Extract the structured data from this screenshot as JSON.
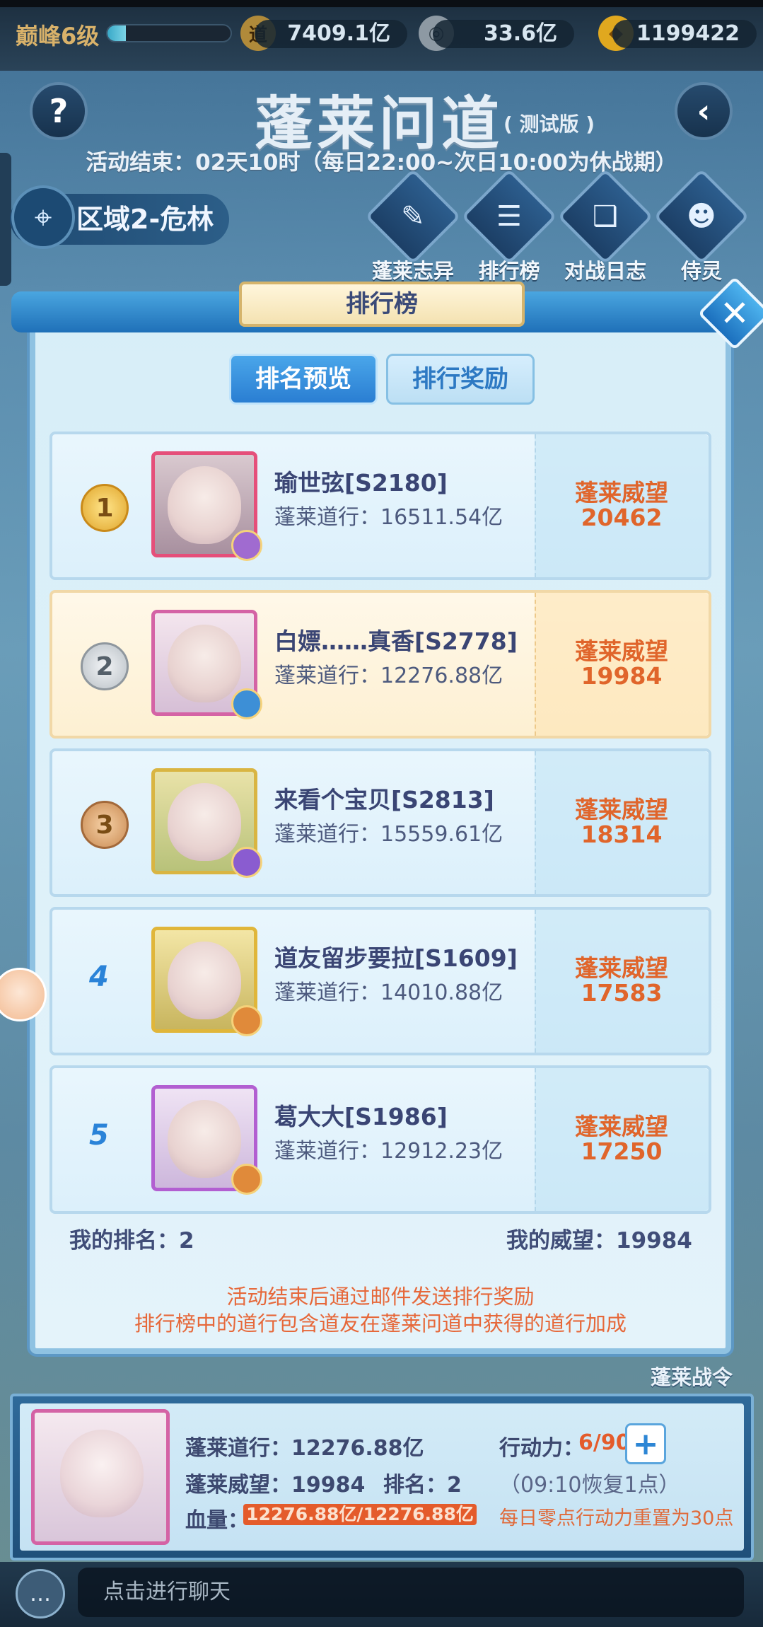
{
  "topbar": {
    "level": "巅峰6级",
    "level_progress": 0.15,
    "daoxing_icon": "道",
    "daoxing": "7409.1亿",
    "silver": "33.6亿",
    "gold": "1199422"
  },
  "header": {
    "title": "蓬莱问道",
    "version_tag": "( 测试版 )",
    "event_time": "活动结束：02天10时（每日22:00~次日10:00为休战期）",
    "region": "区域2-危林",
    "features": [
      "蓬莱志异",
      "排行榜",
      "对战日志",
      "侍灵"
    ]
  },
  "modal": {
    "title": "排行榜",
    "tabs": [
      "排名预览",
      "排行奖励"
    ],
    "active_tab": "排名预览",
    "prestige_label": "蓬莱威望",
    "rows": [
      {
        "rank": "1",
        "name": "瑜世弦[S2180]",
        "stat": "蓬莱道行：16511.54亿",
        "prestige": "20462"
      },
      {
        "rank": "2",
        "name": "白嫖……真香[S2778]",
        "stat": "蓬莱道行：12276.88亿",
        "prestige": "19984",
        "is_me": true
      },
      {
        "rank": "3",
        "name": "来看个宝贝[S2813]",
        "stat": "蓬莱道行：15559.61亿",
        "prestige": "18314"
      },
      {
        "rank": "4",
        "name": "道友留步要拉[S1609]",
        "stat": "蓬莱道行：14010.88亿",
        "prestige": "17583"
      },
      {
        "rank": "5",
        "name": "葛大大[S1986]",
        "stat": "蓬莱道行：12912.23亿",
        "prestige": "17250"
      }
    ],
    "my_rank": "我的排名：2",
    "my_prestige": "我的威望：19984",
    "note_1": "活动结束后通过邮件发送排行奖励",
    "note_2": "排行榜中的道行包含道友在蓬莱问道中获得的道行加成"
  },
  "side": {
    "battle_order": "蓬莱战令"
  },
  "panel": {
    "daoxing": "蓬莱道行：12276.88亿",
    "prestige": "蓬莱威望：19984",
    "rank": "排名：2",
    "hp_label": "血量：",
    "hp_value": "12276.88亿/12276.88亿",
    "action_label": "行动力：",
    "action_value": "6/90",
    "recover": "（09:10恢复1点）",
    "reset_note": "每日零点行动力重置为30点"
  },
  "chat": {
    "placeholder": "点击进行聊天"
  },
  "colors": {
    "accent": "#2a7ed2",
    "prestige": "#e0652b",
    "hp": "#e45b2b"
  }
}
